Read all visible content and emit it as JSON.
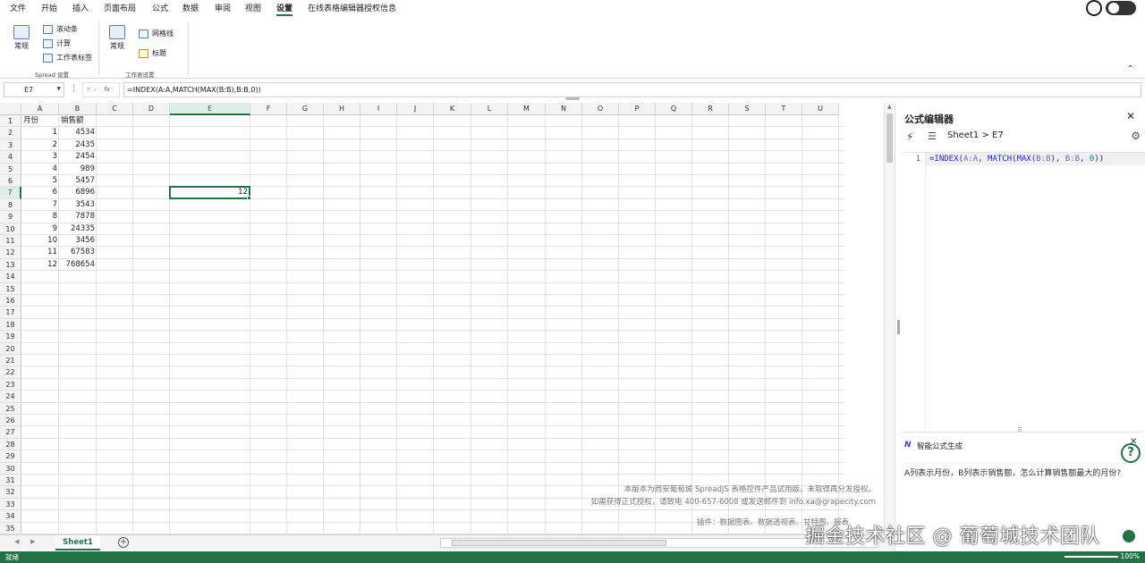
{
  "menu": [
    "文件",
    "开始",
    "插入",
    "页面布局",
    "公式",
    "数据",
    "审阅",
    "视图",
    "设置",
    "在线表格编辑器授权信息"
  ],
  "ribbon": {
    "spread_general": "常规",
    "scrollbar": "滚动条",
    "calc": "计算",
    "sheet_tabs": "工作表标签",
    "spread_group": "Spread 设置",
    "sheet_general": "常规",
    "gridlines": "网格线",
    "headers": "标题",
    "sheet_group": "工作表设置"
  },
  "formula_bar": {
    "name_box": "E7",
    "formula": "=INDEX(A:A,MATCH(MAX(B:B),B:B,0))"
  },
  "grid": {
    "columns": [
      "A",
      "B",
      "C",
      "D",
      "E",
      "F",
      "G",
      "H",
      "I",
      "J",
      "K",
      "L",
      "M",
      "N",
      "O",
      "P",
      "Q",
      "R",
      "S",
      "T",
      "U"
    ],
    "rows": [
      "1",
      "2",
      "3",
      "4",
      "5",
      "6",
      "7",
      "8",
      "9",
      "10",
      "11",
      "12",
      "13",
      "14",
      "15",
      "16",
      "17",
      "18",
      "19",
      "20",
      "21",
      "22",
      "23",
      "24",
      "25",
      "26",
      "27",
      "28",
      "29",
      "30",
      "31",
      "32",
      "33",
      "34",
      "35"
    ],
    "header_a": "月份",
    "header_b": "销售额",
    "months": [
      "1",
      "2",
      "3",
      "4",
      "5",
      "6",
      "7",
      "8",
      "9",
      "10",
      "11",
      "12"
    ],
    "sales": [
      "4534",
      "2435",
      "2454",
      "989",
      "5457",
      "6896",
      "3543",
      "7878",
      "24335",
      "3456",
      "67583",
      "768654"
    ],
    "e7_value": "12"
  },
  "watermark": {
    "line1": "本版本为西安葡萄城 SpreadJS 表格控件产品试用版，未取得再分发授权。",
    "line2": "如需获得正式授权，请致电 400-657-6008 或发送邮件到  info.xa@grapecity.com",
    "line3": "插件：数据图表、数据透视表、甘特图、报表"
  },
  "sheet_tab": "Sheet1",
  "status": {
    "text": "就绪",
    "zoom": "100%"
  },
  "panel": {
    "title": "公式编辑器",
    "path": "Sheet1 > E7",
    "line_no": "1",
    "code": {
      "eq": "=",
      "index": "INDEX(",
      "a": "A:A",
      "match": ", MATCH(",
      "max": "MAX(",
      "b1": "B:B",
      "close1": "), ",
      "b2": "B:B",
      "comma": ", ",
      "zero": "0",
      "close2": "))"
    },
    "help": "?",
    "ai_title": "智能公式生成",
    "ai_prompt": "A列表示月份，B列表示销售额，怎么计算销售额最大的月份?"
  },
  "overlay": "掘金技术社区 @ 葡萄城技术团队"
}
